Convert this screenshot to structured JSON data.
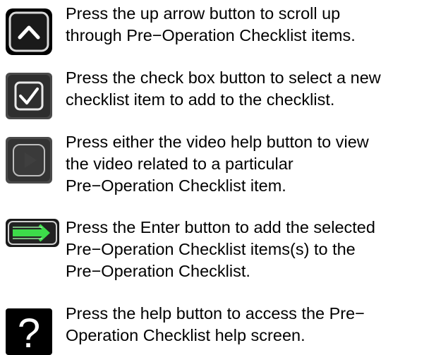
{
  "instructions": [
    {
      "icon": "up-arrow-icon",
      "lines": [
        "Press the up arrow button to scroll up",
        "through Pre−Operation Checklist items."
      ]
    },
    {
      "icon": "check-box-icon",
      "lines": [
        "Press the check box button to select a new",
        "checklist item to add to the checklist."
      ]
    },
    {
      "icon": "video-help-icon",
      "lines": [
        "Press either the video help button to view",
        "the video related to a particular",
        "Pre−Operation Checklist item."
      ]
    },
    {
      "icon": "enter-arrow-icon",
      "lines": [
        "Press the Enter button to add the selected",
        "Pre−Operation Checklist items(s) to the",
        "Pre−Operation Checklist."
      ]
    },
    {
      "icon": "question-mark-icon",
      "lines": [
        "Press the help button to access the Pre−",
        "Operation Checklist help screen."
      ]
    }
  ],
  "colors": {
    "button_dark": "#1a1a1a",
    "button_border": "#cfcfcf",
    "enter_green": "#3ddc4a"
  }
}
